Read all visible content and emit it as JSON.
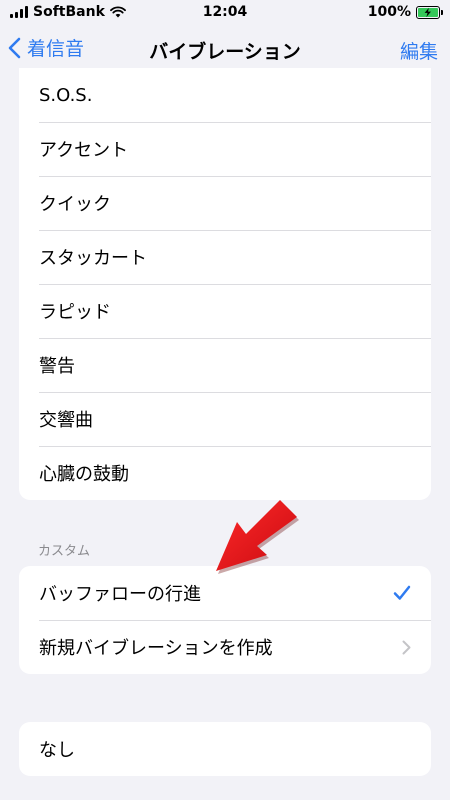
{
  "status_bar": {
    "carrier": "SoftBank",
    "time": "12:04",
    "battery": "100%"
  },
  "nav": {
    "back_label": "着信音",
    "title": "バイブレーション",
    "edit_label": "編集"
  },
  "standard_list": [
    "S.O.S.",
    "アクセント",
    "クイック",
    "スタッカート",
    "ラピッド",
    "警告",
    "交響曲",
    "心臓の鼓動"
  ],
  "custom": {
    "header": "カスタム",
    "selected_item": "バッファローの行進",
    "create_item": "新規バイブレーションを作成"
  },
  "none_item": "なし",
  "colors": {
    "accent": "#2f7bf0",
    "annotation": "#e8151b",
    "background": "#f2f2f7"
  },
  "icons": [
    "wifi-icon",
    "battery-charging-icon",
    "chevron-left-icon",
    "checkmark-icon",
    "chevron-right-icon",
    "red-arrow-annotation"
  ]
}
